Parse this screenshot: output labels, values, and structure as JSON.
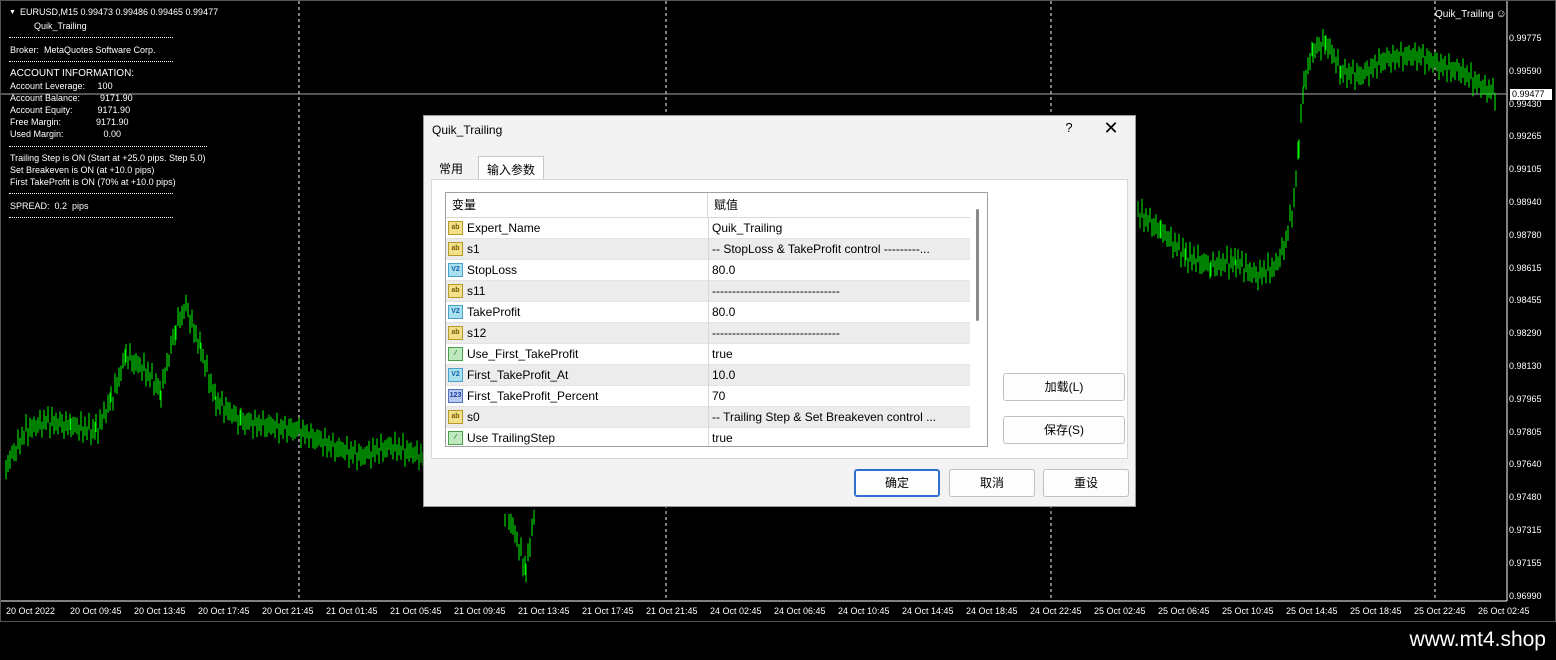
{
  "chart": {
    "symbol_line": "EURUSD,M15  0.99473 0.99486 0.99465 0.99477",
    "ea_name_top": "Quik_Trailing",
    "ea_name_right": "Quik_Trailing",
    "info": {
      "broker": "Broker:  MetaQuotes Software Corp.",
      "account_header": "ACCOUNT INFORMATION:",
      "account_lines": [
        "Account Leverage:     100",
        "Account Balance:        9171.90",
        "Account Equity:          9171.90",
        "Free Margin:              9171.90",
        "Used Margin:                0.00"
      ],
      "status_lines": [
        "Trailing Step is ON (Start at +25.0 pips. Step 5.0)",
        "Set Breakeven is ON (at +10.0 pips)",
        "First TakeProfit is ON (70% at +10.0 pips)"
      ],
      "spread": "SPREAD:  0.2  pips"
    },
    "current_price": "0.99477",
    "price_ticks": [
      "0.99775",
      "0.99590",
      "0.99430",
      "0.99265",
      "0.99105",
      "0.98940",
      "0.98780",
      "0.98615",
      "0.98455",
      "0.98290",
      "0.98130",
      "0.97965",
      "0.97805",
      "0.97640",
      "0.97480",
      "0.97315",
      "0.97155",
      "0.96990"
    ],
    "time_ticks": [
      "20 Oct 2022",
      "20 Oct 09:45",
      "20 Oct 13:45",
      "20 Oct 17:45",
      "20 Oct 21:45",
      "21 Oct 01:45",
      "21 Oct 05:45",
      "21 Oct 09:45",
      "21 Oct 13:45",
      "21 Oct 17:45",
      "21 Oct 21:45",
      "24 Oct 02:45",
      "24 Oct 06:45",
      "24 Oct 10:45",
      "24 Oct 14:45",
      "24 Oct 18:45",
      "24 Oct 22:45",
      "25 Oct 02:45",
      "25 Oct 06:45",
      "25 Oct 10:45",
      "25 Oct 14:45",
      "25 Oct 18:45",
      "25 Oct 22:45",
      "26 Oct 02:45"
    ],
    "candle_color": "#00ff00"
  },
  "dialog": {
    "title": "Quik_Trailing",
    "help_label": "?",
    "close_label": "✕",
    "tabs": [
      {
        "label": "常用"
      },
      {
        "label": "输入参数"
      }
    ],
    "columns": {
      "variable": "变量",
      "value": "赋值"
    },
    "rows": [
      {
        "icon": "ab",
        "name": "Expert_Name",
        "value": "Quik_Trailing"
      },
      {
        "icon": "ab",
        "name": "s1",
        "value": "-- StopLoss & TakeProfit control ---------..."
      },
      {
        "icon": "v2",
        "name": "StopLoss",
        "value": "80.0"
      },
      {
        "icon": "ab",
        "name": "s11",
        "value": "--------------------------------"
      },
      {
        "icon": "v2",
        "name": "TakeProfit",
        "value": "80.0"
      },
      {
        "icon": "ab",
        "name": "s12",
        "value": "--------------------------------"
      },
      {
        "icon": "bool",
        "name": "Use_First_TakeProfit",
        "value": "true"
      },
      {
        "icon": "v2",
        "name": "First_TakeProfit_At",
        "value": "10.0"
      },
      {
        "icon": "num",
        "name": "First_TakeProfit_Percent",
        "value": "70"
      },
      {
        "icon": "ab",
        "name": "s0",
        "value": "-- Trailing Step & Set Breakeven control ..."
      },
      {
        "icon": "bool",
        "name": "Use TrailingStep",
        "value": "true"
      }
    ],
    "icon_text": {
      "ab": "ab",
      "v2": "V2",
      "bool": "⁄",
      "num": "123"
    },
    "buttons": {
      "load": "加载(L)",
      "save": "保存(S)",
      "ok": "确定",
      "cancel": "取消",
      "reset": "重设"
    }
  },
  "watermark": "www.mt4.shop"
}
